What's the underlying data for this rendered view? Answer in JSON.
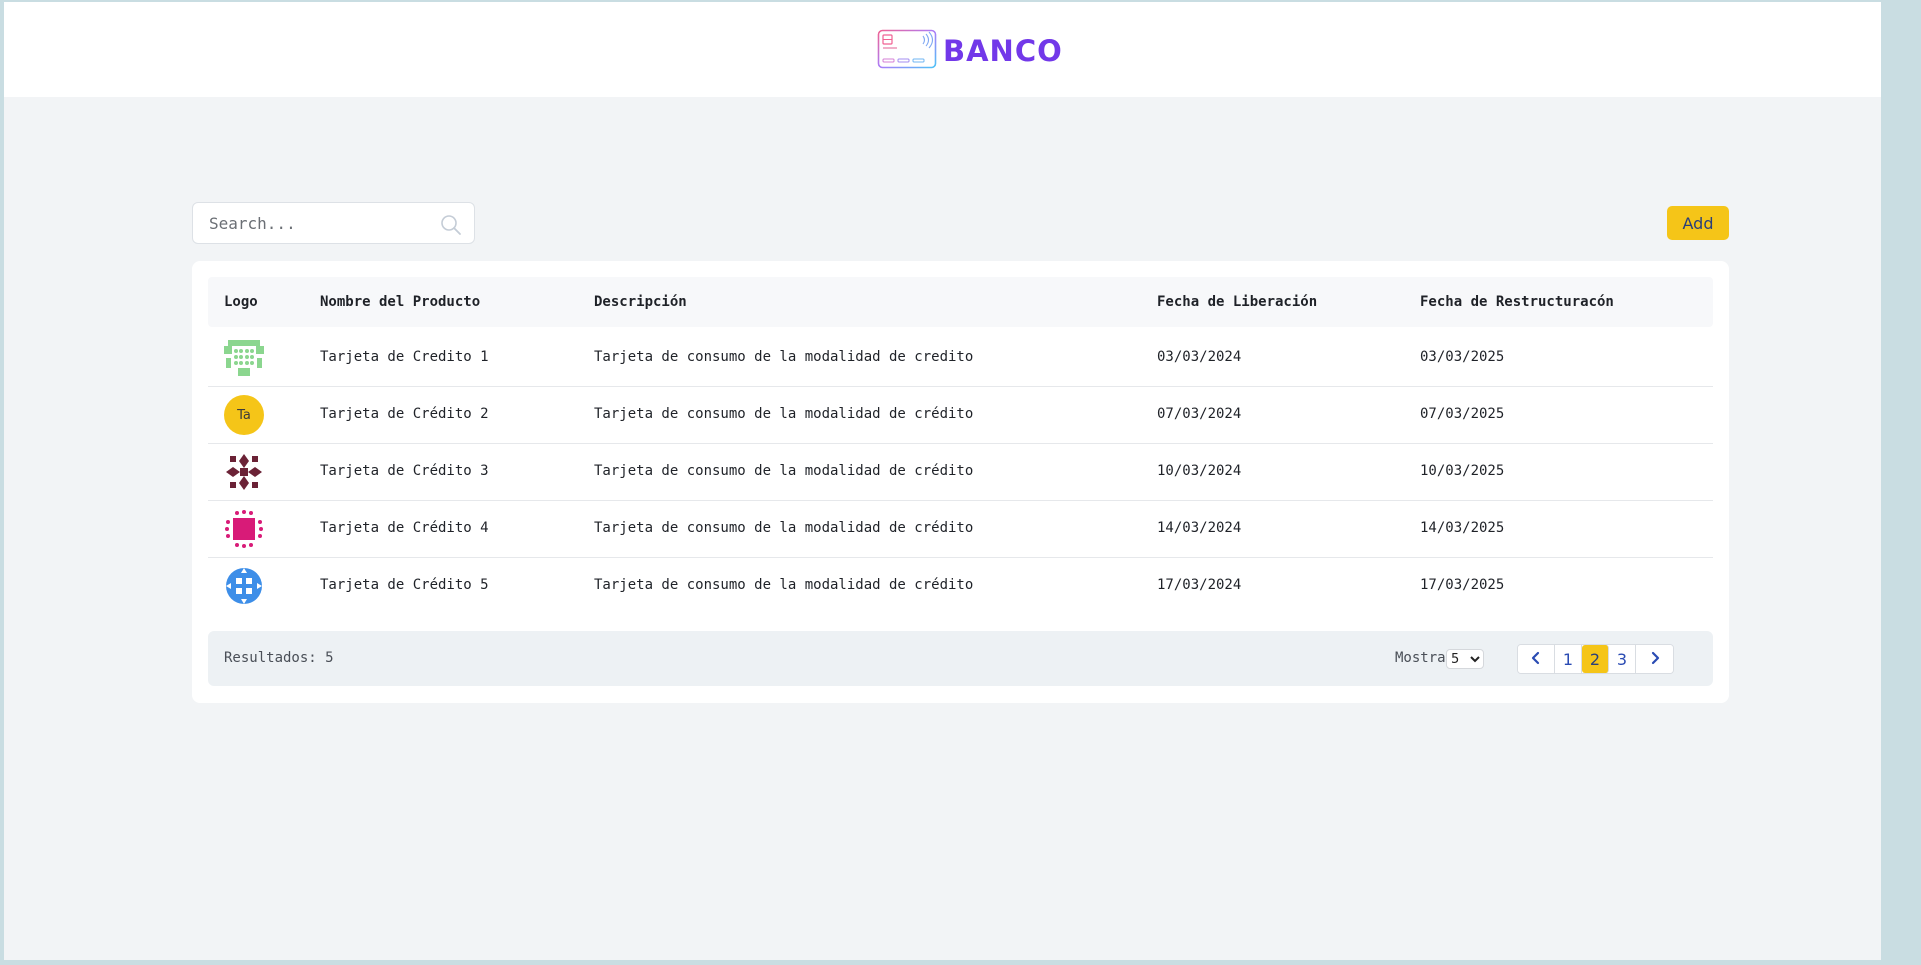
{
  "header": {
    "brand": "BANCO"
  },
  "toolbar": {
    "search_placeholder": "Search...",
    "add_label": "Add"
  },
  "table": {
    "columns": [
      "Logo",
      "Nombre del Producto",
      "Descripción",
      "Fecha de Liberación",
      "Fecha de Restructuracón"
    ],
    "rows": [
      {
        "logo": "green-pattern-icon",
        "name": "Tarjeta de Credito 1",
        "description": "Tarjeta de consumo de la modalidad de credito",
        "release": "03/03/2024",
        "restructure": "03/03/2025"
      },
      {
        "logo": "initials",
        "initials": "Ta",
        "name": "Tarjeta de Crédito 2",
        "description": "Tarjeta de consumo de la modalidad de crédito",
        "release": "07/03/2024",
        "restructure": "07/03/2025"
      },
      {
        "logo": "maroon-pattern-icon",
        "name": "Tarjeta de Crédito 3",
        "description": "Tarjeta de consumo de la modalidad de crédito",
        "release": "10/03/2024",
        "restructure": "10/03/2025"
      },
      {
        "logo": "pink-pattern-icon",
        "name": "Tarjeta de Crédito 4",
        "description": "Tarjeta de consumo de la modalidad de crédito",
        "release": "14/03/2024",
        "restructure": "14/03/2025"
      },
      {
        "logo": "blue-pattern-icon",
        "name": "Tarjeta de Crédito 5",
        "description": "Tarjeta de consumo de la modalidad de crédito",
        "release": "17/03/2024",
        "restructure": "17/03/2025"
      }
    ]
  },
  "footer": {
    "results_label": "Resultados: 5",
    "show_label": "Mostrar:",
    "page_size": "5",
    "pages": [
      "1",
      "2",
      "3"
    ],
    "current_page": "2"
  },
  "colors": {
    "accent": "#f5c518",
    "brand": "#7238e9",
    "link": "#2a4bb3"
  }
}
